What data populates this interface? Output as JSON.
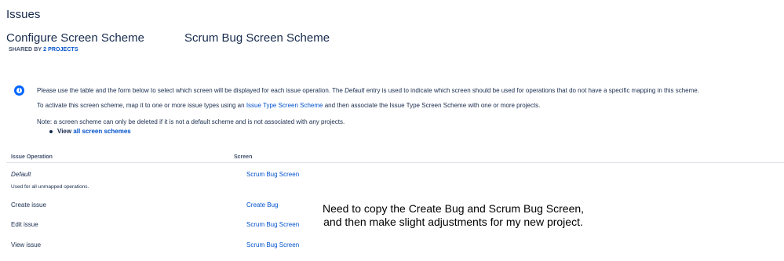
{
  "header": {
    "section": "Issues",
    "page_title": "Configure Screen Scheme",
    "scheme_name": "Scrum Bug Screen Scheme",
    "shared_prefix": "SHARED BY",
    "shared_link": "2 PROJECTS"
  },
  "info": {
    "icon": "info-icon",
    "line1_pre": "Please use the table and the form below to select which screen will be displayed for each issue operation. The",
    "line1_italic": "Default",
    "line1_post": "entry is used to indicate which screen should be used for operations that do not have a specific mapping in this scheme.",
    "line2_pre": "To activate this screen scheme, map it to one or more issue types using an",
    "line2_link": "Issue Type Screen Scheme",
    "line2_post": "and then associate the Issue Type Screen Scheme with one or more projects.",
    "line3": "Note: a screen scheme can only be deleted if it is not a default scheme and is not associated with any projects.",
    "bullet_prefix": "View",
    "bullet_link": "all screen schemes"
  },
  "table": {
    "headers": [
      "Issue Operation",
      "Screen"
    ],
    "rows": [
      {
        "operation": "Default",
        "note": "Used for all unmapped operations.",
        "screen": "Scrum Bug Screen"
      },
      {
        "operation": "Create issue",
        "screen": "Create Bug"
      },
      {
        "operation": "Edit issue",
        "screen": "Scrum Bug Screen"
      },
      {
        "operation": "View issue",
        "screen": "Scrum Bug Screen"
      }
    ]
  },
  "annotation": {
    "text": "Need to copy the Create Bug and Scrum Bug Screen, and then make slight adjustments for my new project."
  },
  "colors": {
    "link": "#0052cc",
    "text": "#172b4d",
    "info_icon": "#0065ff"
  }
}
